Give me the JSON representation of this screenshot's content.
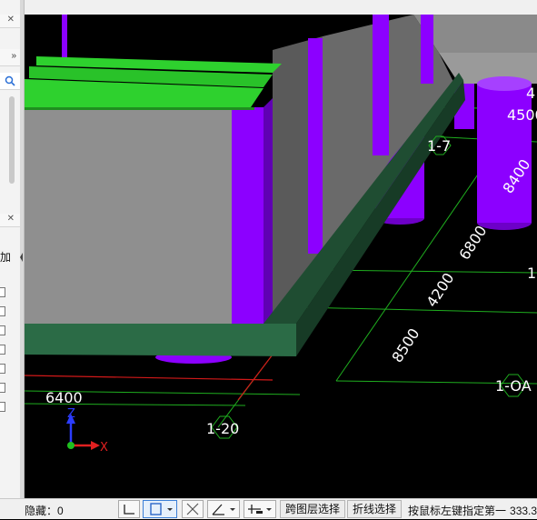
{
  "left_panel": {
    "close_icon": "close-icon",
    "expand_icon": "double-chevron-right-icon",
    "search_icon": "search-icon",
    "partial_label": "加"
  },
  "viewport": {
    "dimensions": [
      "6400",
      "6800",
      "4200",
      "8500",
      "8400",
      "4500",
      "4"
    ],
    "axis_labels": [
      "1-20",
      "1-OA",
      "1-7",
      "1"
    ],
    "triad": {
      "z": "Z",
      "x": "X"
    },
    "colors": {
      "column": "#8c00ff",
      "beam_green": "#2ed12e",
      "slab_dark_green": "#1f4d32",
      "wall_gray": "#8f8f8f",
      "grid_line": "#1fae1f"
    }
  },
  "status_bar": {
    "hidden_label": "隐藏：0",
    "cross_layer_select": "跨图层选择",
    "polyline_select": "折线选择",
    "prompt": "按鼠标左键指定第一",
    "coord": "333.3"
  }
}
